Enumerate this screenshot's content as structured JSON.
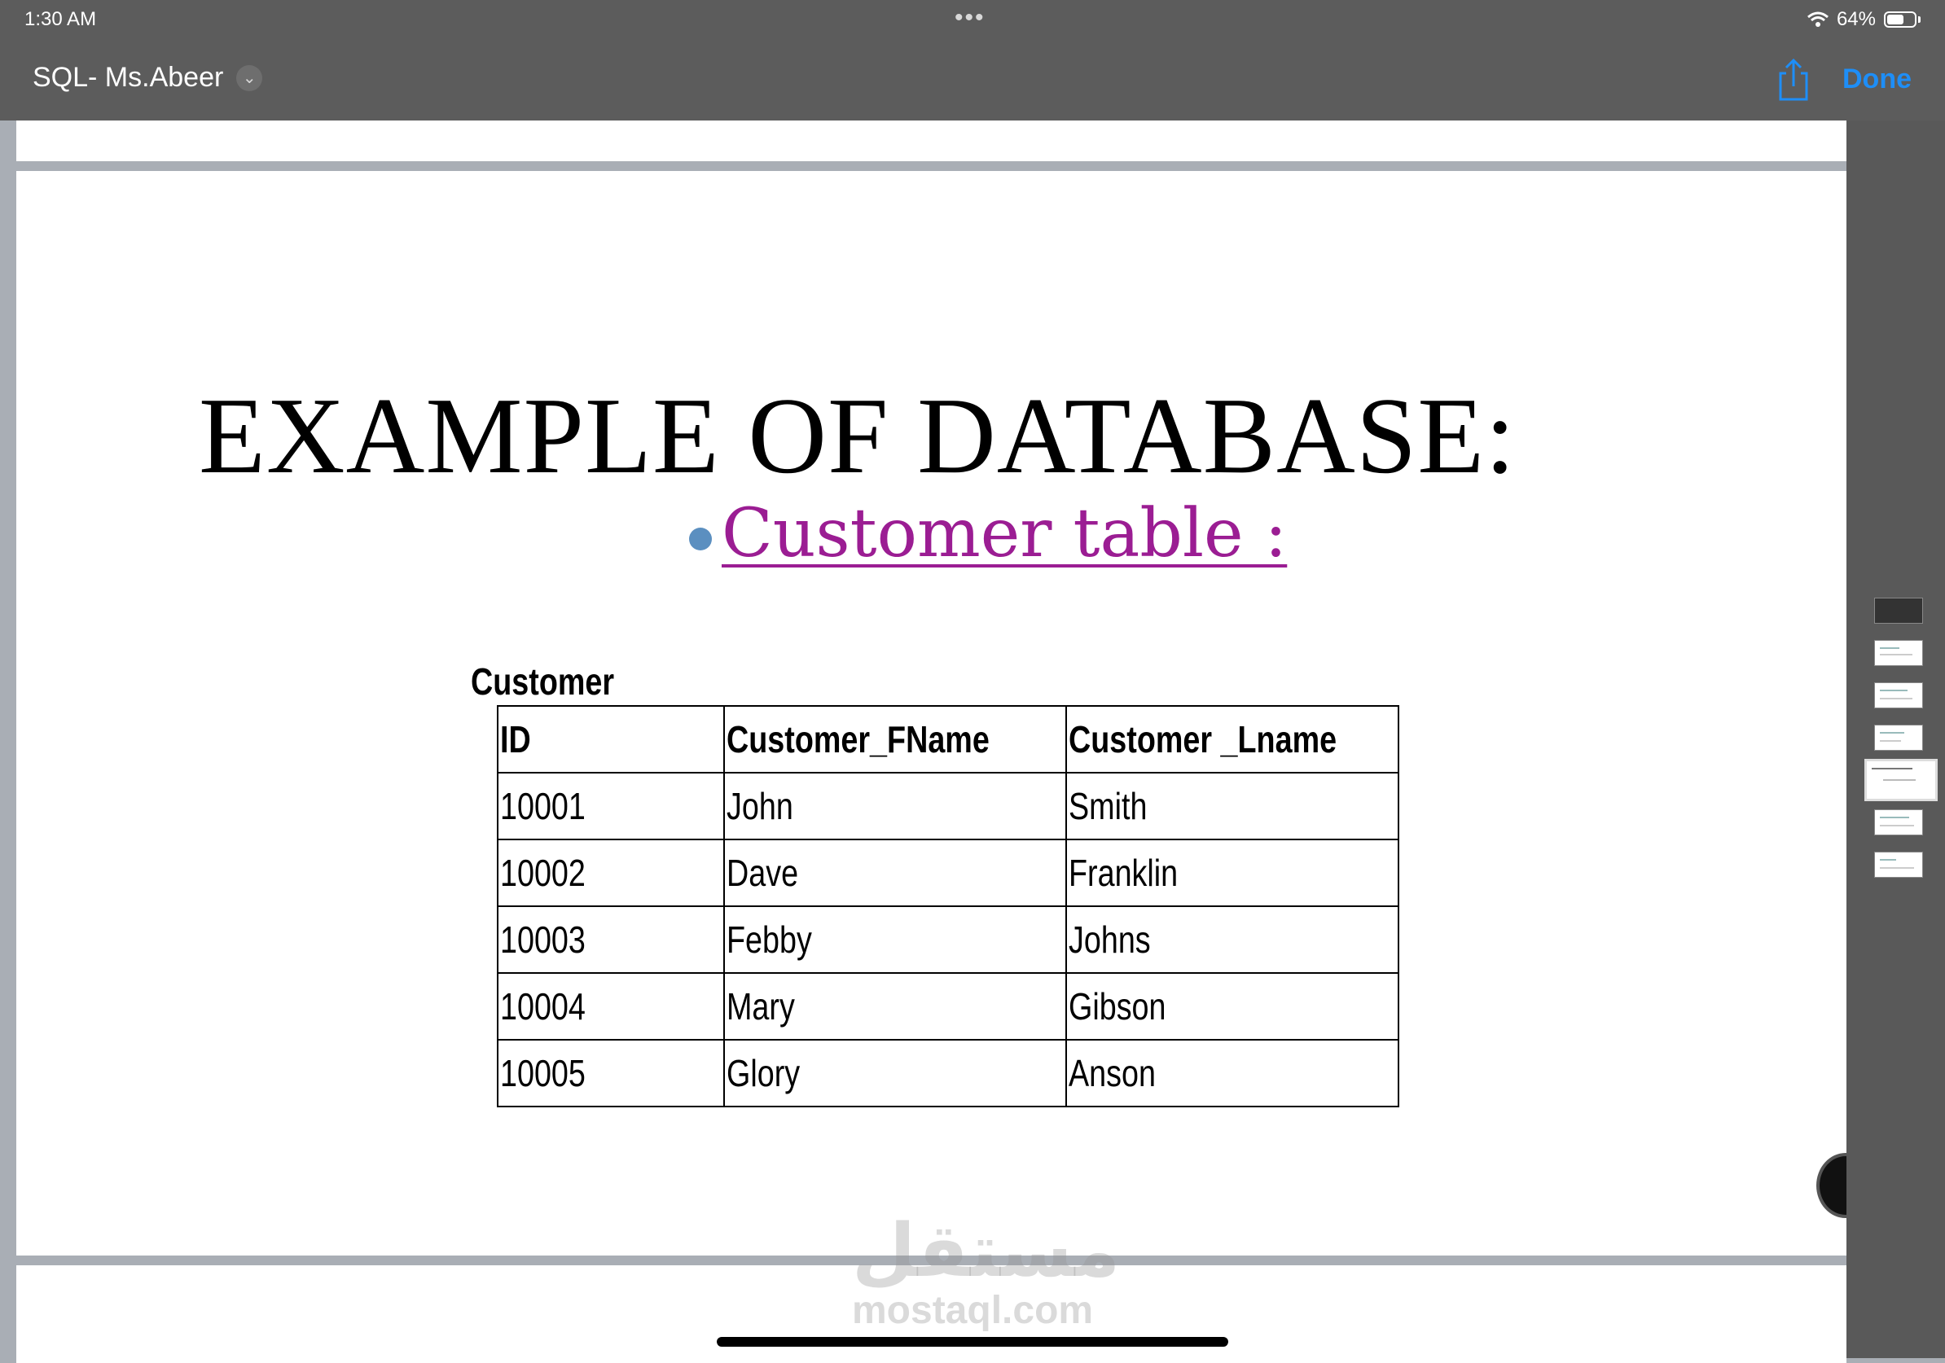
{
  "status_bar": {
    "time": "1:30 AM",
    "dots": "•••",
    "battery_percent": "64%",
    "battery_level": 0.64
  },
  "toolbar": {
    "document_title": "SQL- Ms.Abeer",
    "done_label": "Done"
  },
  "slide": {
    "title": "EXAMPLE OF DATABASE:",
    "subheading": " Customer table :",
    "table_caption": "Customer",
    "table": {
      "headers": [
        "ID",
        "Customer_FName",
        "Customer _Lname"
      ],
      "rows": [
        [
          "10001",
          "John",
          "Smith"
        ],
        [
          "10002",
          "Dave",
          "Franklin"
        ],
        [
          "10003",
          "Febby",
          "Johns"
        ],
        [
          "10004",
          "Mary",
          "Gibson"
        ],
        [
          "10005",
          "Glory",
          "Anson"
        ]
      ]
    }
  },
  "watermark": {
    "arabic": "مستقل",
    "latin": "mostaql.com"
  },
  "thumbnails": {
    "count": 7,
    "selected_index": 4
  },
  "colors": {
    "accent": "#1e8ef7",
    "subheading": "#9b1d93",
    "bullet": "#5b8fc0",
    "toolbar": "#5c5c5c"
  }
}
